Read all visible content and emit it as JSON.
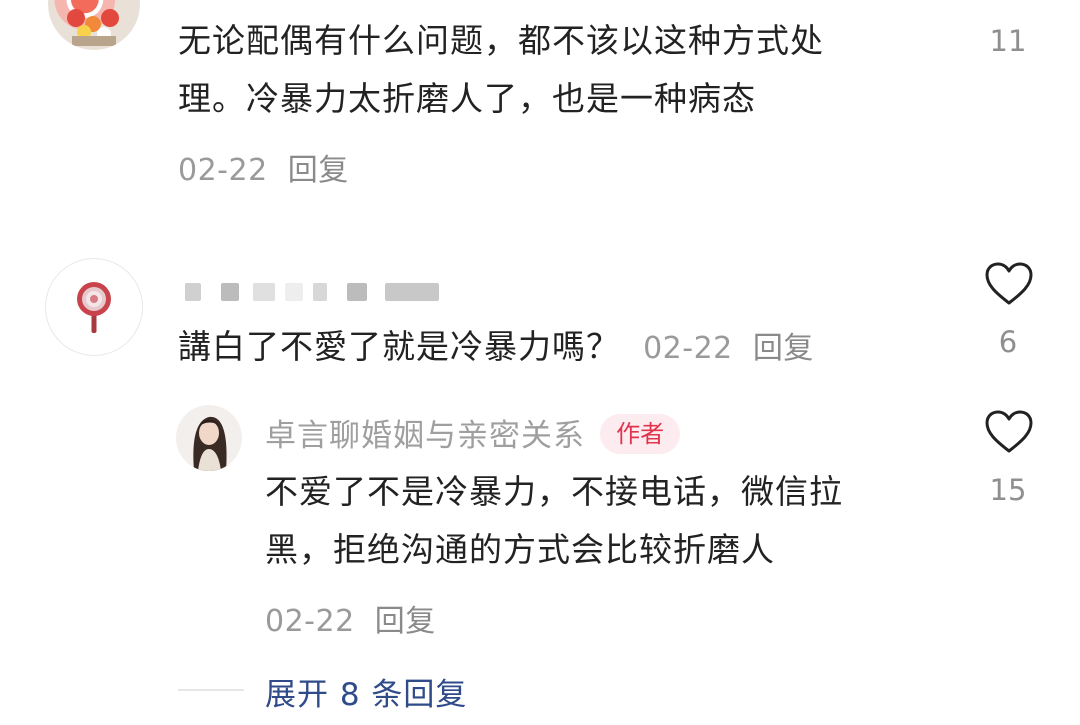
{
  "comments": [
    {
      "text_line1": "无论配偶有什么问题，都不该以这种方式处",
      "text_line2": "理。冷暴力太折磨人了，也是一种病态",
      "date": "02-22",
      "reply_label": "回复",
      "likes": "11",
      "like_icon": "heart-outline-icon"
    },
    {
      "text": "講白了不愛了就是冷暴力嗎？",
      "date": "02-22",
      "reply_label": "回复",
      "likes": "6",
      "like_icon": "heart-outline-icon",
      "replies": [
        {
          "username": "卓言聊婚姻与亲密关系",
          "badge": "作者",
          "text_line1": "不爱了不是冷暴力，不接电话，微信拉",
          "text_line2": "黑，拒绝沟通的方式会比较折磨人",
          "date": "02-22",
          "reply_label": "回复",
          "likes": "15",
          "like_icon": "heart-outline-icon"
        }
      ],
      "expand_label": "展开 8 条回复"
    }
  ],
  "colors": {
    "badge_text": "#e0334d",
    "badge_bg": "#fdecef",
    "expand_link": "#2f4b8a"
  }
}
